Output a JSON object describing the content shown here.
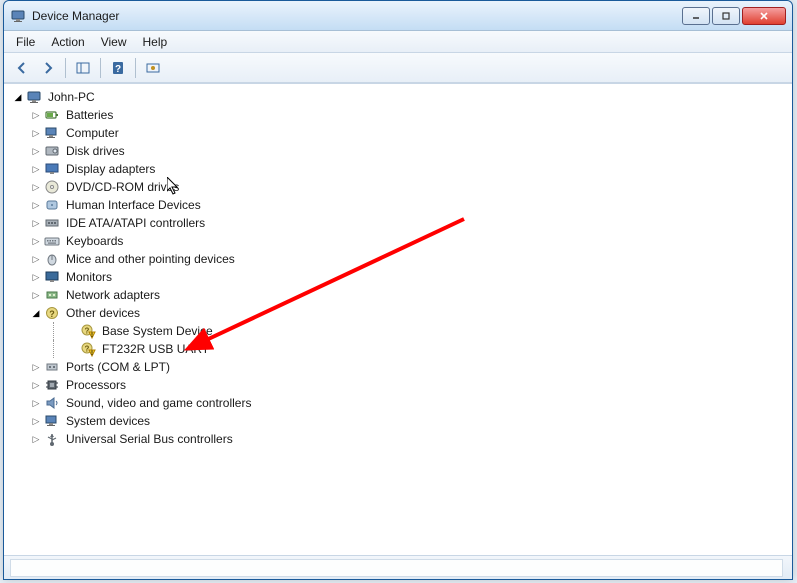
{
  "window": {
    "title": "Device Manager"
  },
  "menu": {
    "file": "File",
    "action": "Action",
    "view": "View",
    "help": "Help"
  },
  "tree": {
    "root": "John-PC",
    "categories": [
      {
        "label": "Batteries",
        "icon": "battery"
      },
      {
        "label": "Computer",
        "icon": "computer"
      },
      {
        "label": "Disk drives",
        "icon": "disk"
      },
      {
        "label": "Display adapters",
        "icon": "display"
      },
      {
        "label": "DVD/CD-ROM drives",
        "icon": "cdrom"
      },
      {
        "label": "Human Interface Devices",
        "icon": "hid"
      },
      {
        "label": "IDE ATA/ATAPI controllers",
        "icon": "ide"
      },
      {
        "label": "Keyboards",
        "icon": "keyboard"
      },
      {
        "label": "Mice and other pointing devices",
        "icon": "mouse"
      },
      {
        "label": "Monitors",
        "icon": "monitor"
      },
      {
        "label": "Network adapters",
        "icon": "network"
      },
      {
        "label": "Other devices",
        "icon": "other",
        "expanded": true,
        "children": [
          {
            "label": "Base System Device",
            "warn": true
          },
          {
            "label": "FT232R USB UART",
            "warn": true
          }
        ]
      },
      {
        "label": "Ports (COM & LPT)",
        "icon": "port"
      },
      {
        "label": "Processors",
        "icon": "cpu"
      },
      {
        "label": "Sound, video and game controllers",
        "icon": "sound"
      },
      {
        "label": "System devices",
        "icon": "system"
      },
      {
        "label": "Universal Serial Bus controllers",
        "icon": "usb"
      }
    ]
  },
  "annotation": {
    "arrow_color": "#ff0000",
    "target": "FT232R USB UART"
  }
}
